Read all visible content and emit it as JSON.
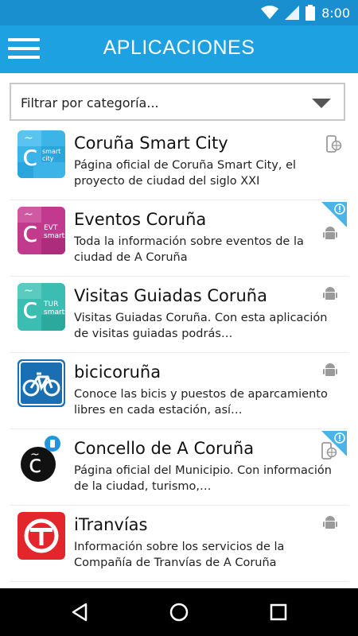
{
  "status": {
    "time": "8:00"
  },
  "header": {
    "title": "APLICACIONES"
  },
  "filter": {
    "placeholder": "Filtrar por categoría..."
  },
  "apps": [
    {
      "title": "Coruña Smart City",
      "description": "Página oficial de Coruña Smart City, el proyecto de ciudad del siglo XXI",
      "icon_text": "smart city",
      "platform": "web-icon",
      "badge": false
    },
    {
      "title": "Eventos Coruña",
      "description": "Toda la información sobre eventos de la ciudad de A Coruña",
      "icon_text": "EVT smart",
      "platform": "android-icon",
      "badge": true
    },
    {
      "title": "Visitas Guiadas Coruña",
      "description": "Visitas Guiadas Coruña. Con esta aplicación de visitas guiadas podrás…",
      "icon_text": "TUR smart",
      "platform": "android-icon",
      "badge": false
    },
    {
      "title": "bicicoruña",
      "description": "Conoce las bicis y puestos de aparcamiento libres en cada estación, así…",
      "icon_text": "",
      "platform": "android-icon",
      "badge": false
    },
    {
      "title": "Concello de A Coruña",
      "description": "Página oficial del Municipio. Con información de la ciudad, turismo,…",
      "icon_text": "",
      "platform": "web-icon",
      "badge": true
    },
    {
      "title": "iTranvías",
      "description": "Información sobre los servicios de la Compañía de Tranvías de A Coruña",
      "icon_text": "",
      "platform": "android-icon",
      "badge": false
    }
  ],
  "colors": {
    "status_bar": "#1a8fd0",
    "app_bar": "#1da1e0",
    "badge": "#4cb3e6"
  }
}
